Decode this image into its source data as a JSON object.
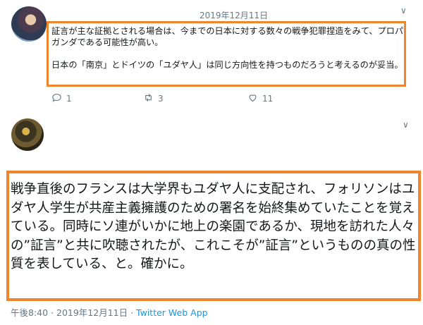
{
  "tweet1": {
    "timestamp": "2019年12月11日",
    "text": "証言が主な証拠とされる場合は、今までの日本に対する数々の戦争犯罪捏造をみて、プロパガンダである可能性が高い。\n\n日本の「南京」とドイツの「ユダヤ人」は同じ方向性を持つものだろうと考えるのが妥当。",
    "reply_count": "1",
    "retweet_count": "3",
    "like_count": "11"
  },
  "tweet2": {
    "text": "戦争直後のフランスは大学界もユダヤ人に支配され、フォリソンはユダヤ人学生が共産主義擁護のための署名を始終集めていたことを覚えている。同時にソ連がいかに地上の楽園であるか、現地を訪れた人々の”証言”と共に吹聴されたが、これこそが”証言”というものの真の性質を表している、と。確かに。",
    "time": "午後8:40",
    "separator": " · ",
    "date": "2019年12月11日",
    "source": "Twitter Web App"
  },
  "colors": {
    "highlight": "#f0852d",
    "link": "#1b95e0",
    "meta": "#657786"
  },
  "icons": [
    "reply-icon",
    "retweet-icon",
    "like-icon",
    "chevron-down-icon"
  ]
}
